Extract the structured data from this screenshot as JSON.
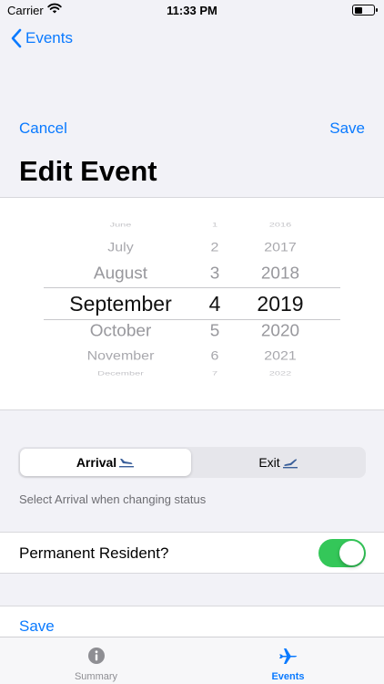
{
  "status_bar": {
    "carrier": "Carrier",
    "time": "11:33 PM"
  },
  "nav": {
    "back_label": "Events",
    "cancel_label": "Cancel",
    "save_label": "Save",
    "title": "Edit Event"
  },
  "date_picker": {
    "rows": [
      {
        "month": "June",
        "day": "1",
        "year": "2016"
      },
      {
        "month": "July",
        "day": "2",
        "year": "2017"
      },
      {
        "month": "August",
        "day": "3",
        "year": "2018"
      },
      {
        "month": "September",
        "day": "4",
        "year": "2019"
      },
      {
        "month": "October",
        "day": "5",
        "year": "2020"
      },
      {
        "month": "November",
        "day": "6",
        "year": "2021"
      },
      {
        "month": "December",
        "day": "7",
        "year": "2022"
      }
    ],
    "selected_index": 3
  },
  "segment": {
    "arrival_label": "Arrival",
    "exit_label": "Exit",
    "selected": "arrival"
  },
  "footnote": "Select Arrival when changing status",
  "permanent_resident": {
    "label": "Permanent Resident?",
    "on": true
  },
  "save_row": {
    "label": "Save"
  },
  "colors": {
    "accent": "#0a7aff",
    "switch_on": "#34c759",
    "inactive_tab": "#8e8e93"
  },
  "tabs": [
    {
      "label": "Summary",
      "icon": "info-icon",
      "active": false
    },
    {
      "label": "Events",
      "icon": "airplane-icon",
      "active": true
    }
  ]
}
